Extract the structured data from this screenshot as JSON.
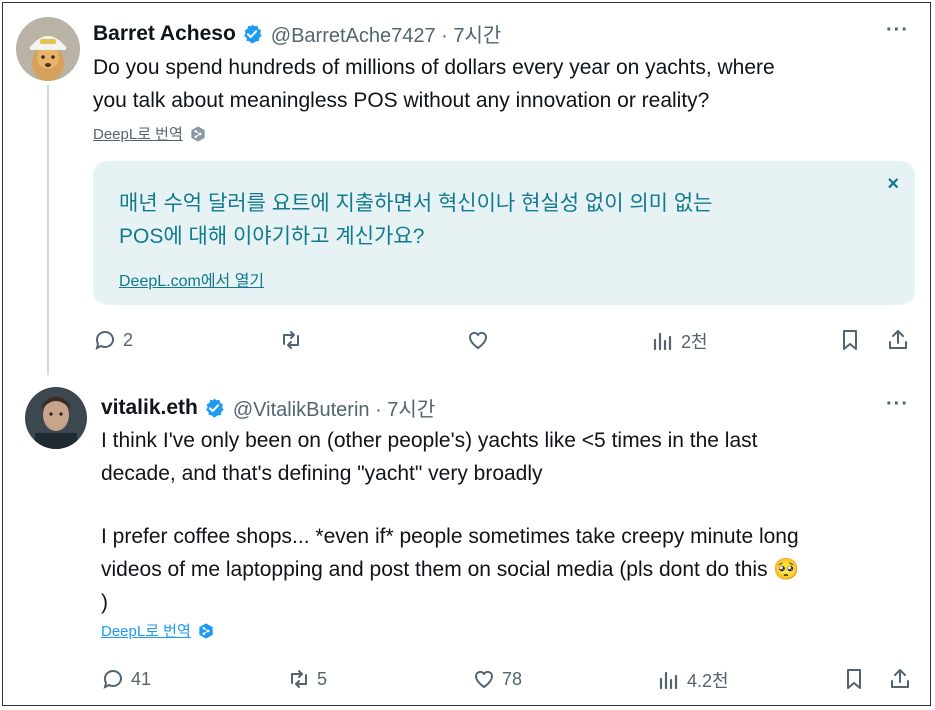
{
  "tweet1": {
    "display_name": "Barret Acheso",
    "handle_time": "@BarretAche7427 · 7시간",
    "text_line1": "Do you spend hundreds of millions of dollars every year on yachts, where",
    "text_line2": "you talk about meaningless POS without any innovation or reality?",
    "translate_label": "DeepL로 번역",
    "translation": {
      "line1": "매년 수억 달러를 요트에 지출하면서 혁신이나 현실성 없이 의미 없는",
      "line2": "POS에 대해 이야기하고 계신가요?",
      "open_link": "DeepL.com에서 열기",
      "close": "×"
    },
    "replies": "2",
    "reposts": "",
    "likes": "",
    "views": "2천"
  },
  "tweet2": {
    "display_name": "vitalik.eth",
    "handle_time": "@VitalikButerin · 7시간",
    "para1_line1": "I think I've only been on (other people's) yachts like <5 times in the last",
    "para1_line2": "decade, and that's defining \"yacht\" very broadly",
    "para2_line1": "I prefer coffee shops... *even if* people sometimes take creepy minute long",
    "para2_line2": "videos of me laptopping and post them on social media (pls dont do this 🥺",
    "para2_line3": ")",
    "translate_label": "DeepL로 번역",
    "replies": "41",
    "reposts": "5",
    "likes": "78",
    "views": "4.2천"
  },
  "more_label": "···",
  "colors": {
    "verified": "#1d9bf0",
    "translation_bg": "#e6f2f4",
    "translation_text": "#117a8b",
    "muted": "#536471"
  },
  "icons": [
    "verified-badge-icon",
    "more-icon",
    "reply-icon",
    "repost-icon",
    "like-icon",
    "views-icon",
    "bookmark-icon",
    "share-icon",
    "deepl-icon"
  ]
}
